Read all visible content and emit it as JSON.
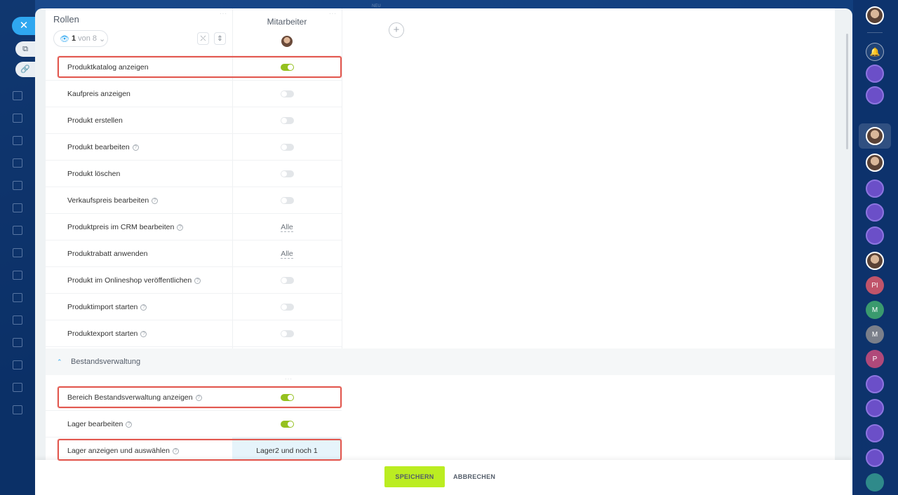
{
  "window": {
    "top_hint": "NEU"
  },
  "left_rail": {
    "close_icon": "close-icon",
    "pill_1_icon": "external-link-icon",
    "pill_2_icon": "link-icon"
  },
  "header": {
    "roles_title": "Rollen",
    "roles_counter_num": "1",
    "roles_counter_rest": "von 8",
    "column_title": "Mitarbeiter"
  },
  "rows": [
    {
      "label": "Produktkatalog anzeigen",
      "help": false,
      "value_type": "toggle",
      "on": true
    },
    {
      "label": "Kaufpreis anzeigen",
      "help": false,
      "value_type": "toggle",
      "on": false
    },
    {
      "label": "Produkt erstellen",
      "help": false,
      "value_type": "toggle",
      "on": false
    },
    {
      "label": "Produkt bearbeiten",
      "help": true,
      "value_type": "toggle",
      "on": false
    },
    {
      "label": "Produkt löschen",
      "help": false,
      "value_type": "toggle",
      "on": false
    },
    {
      "label": "Verkaufspreis bearbeiten",
      "help": true,
      "value_type": "toggle",
      "on": false
    },
    {
      "label": "Produktpreis im CRM bearbeiten",
      "help": true,
      "value_type": "text",
      "value": "Alle"
    },
    {
      "label": "Produktrabatt anwenden",
      "help": false,
      "value_type": "text",
      "value": "Alle"
    },
    {
      "label": "Produkt im Onlineshop veröffentlichen",
      "help": true,
      "value_type": "toggle",
      "on": false
    },
    {
      "label": "Produktimport starten",
      "help": true,
      "value_type": "toggle",
      "on": false
    },
    {
      "label": "Produktexport starten",
      "help": true,
      "value_type": "toggle",
      "on": false
    }
  ],
  "section": {
    "title": "Bestandsverwaltung",
    "rows": [
      {
        "label": "Bereich Bestandsverwaltung anzeigen",
        "help": true,
        "value_type": "toggle",
        "on": true
      },
      {
        "label": "Lager bearbeiten",
        "help": true,
        "value_type": "toggle",
        "on": true
      },
      {
        "label": "Lager anzeigen und auswählen",
        "help": true,
        "value_type": "select",
        "value": "Lager2 und noch 1"
      }
    ]
  },
  "footer": {
    "save_label": "SPEICHERN",
    "cancel_label": "ABBRECHEN"
  },
  "right_rail": {
    "items": [
      {
        "type": "bell",
        "text": ""
      },
      {
        "type": "purple",
        "text": ""
      },
      {
        "type": "purple",
        "text": ""
      },
      {
        "type": "avatar",
        "text": ""
      },
      {
        "type": "avatar",
        "text": ""
      },
      {
        "type": "purple",
        "text": ""
      },
      {
        "type": "purple",
        "text": ""
      },
      {
        "type": "purple",
        "text": ""
      },
      {
        "type": "avatar",
        "text": ""
      },
      {
        "type": "red",
        "text": "PI"
      },
      {
        "type": "green",
        "text": "M"
      },
      {
        "type": "gray",
        "text": "M"
      },
      {
        "type": "pink",
        "text": "P"
      },
      {
        "type": "purple",
        "text": ""
      },
      {
        "type": "purple",
        "text": ""
      },
      {
        "type": "purple",
        "text": ""
      },
      {
        "type": "purple",
        "text": ""
      },
      {
        "type": "teal",
        "text": ""
      }
    ]
  },
  "colors": {
    "accent": "#2fa7f0",
    "toggle_on": "#95c11f",
    "save": "#bbed21",
    "highlight": "#e2584f"
  }
}
